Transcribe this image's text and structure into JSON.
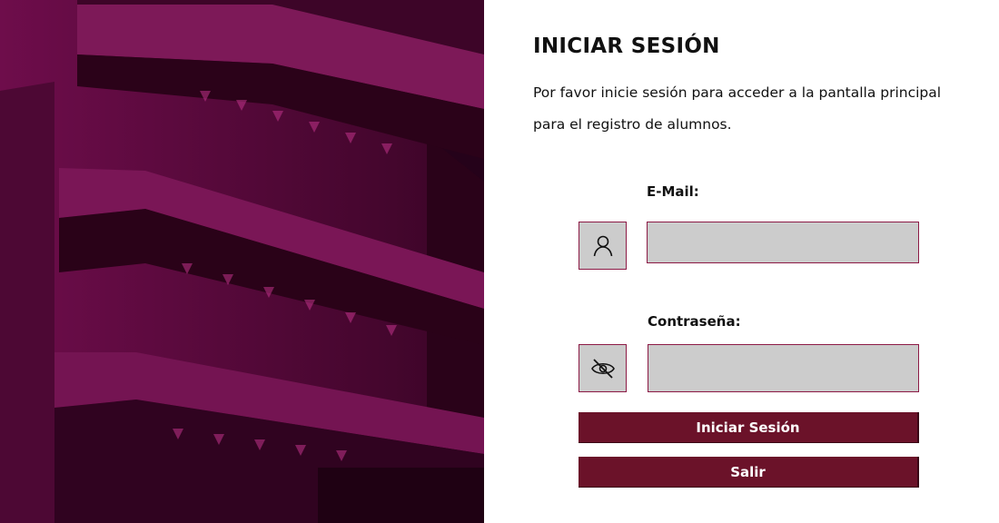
{
  "hero": {
    "description_icon": "building-photo",
    "tint_color": "#5a0a3c"
  },
  "login": {
    "title": "INICIAR SESIÓN",
    "intro": "Por favor inicie sesión para acceder a la pantalla principal para el registro de alumnos.",
    "email_label": "E-Mail:",
    "email_value": "",
    "email_icon": "user-icon",
    "password_label": "Contraseña:",
    "password_value": "",
    "password_icon": "eye-off-icon",
    "login_button": "Iniciar Sesión",
    "exit_button": "Salir"
  },
  "colors": {
    "accent": "#6b1229",
    "field_border": "#8c1a45",
    "field_bg": "#cccccc"
  }
}
